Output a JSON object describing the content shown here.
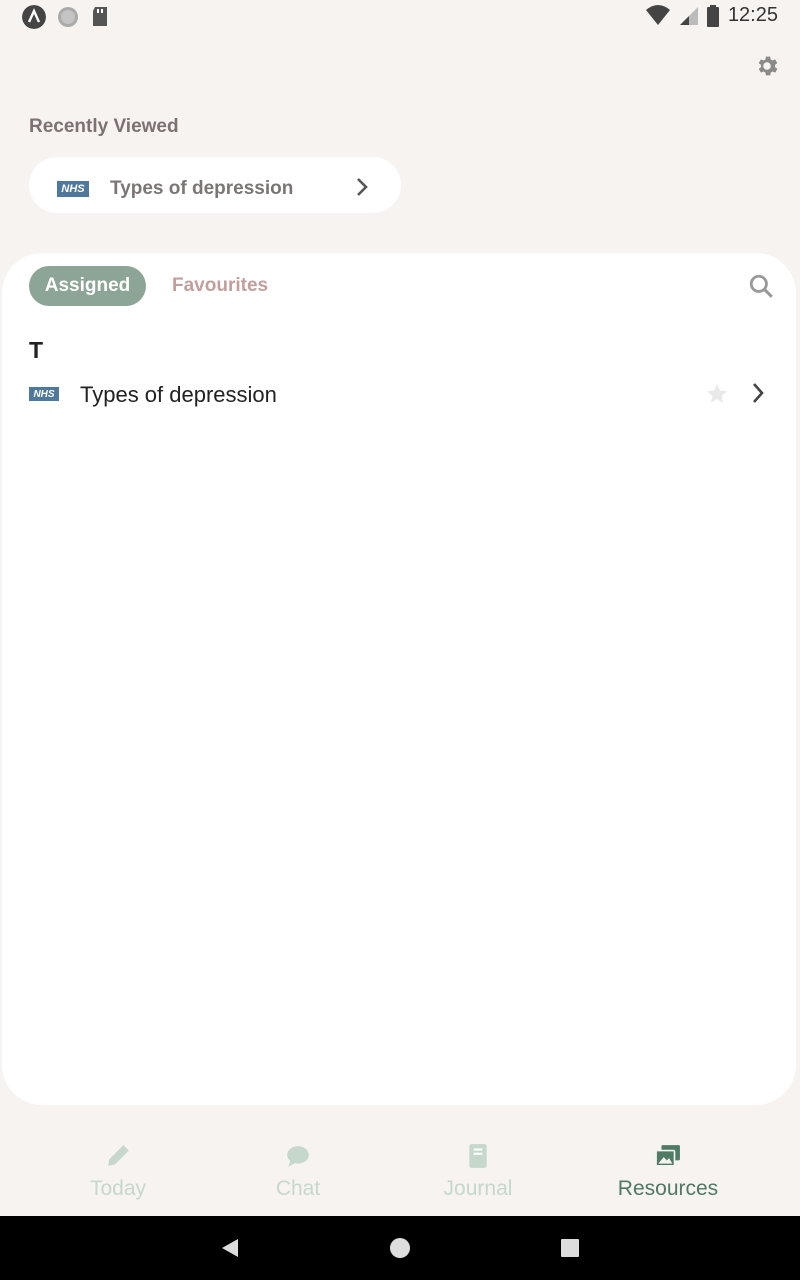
{
  "status_bar": {
    "time": "12:25"
  },
  "recently_viewed": {
    "title": "Recently Viewed",
    "item": {
      "badge": "NHS",
      "label": "Types of depression"
    }
  },
  "tabs": {
    "assigned": "Assigned",
    "favourites": "Favourites"
  },
  "section": {
    "letter": "T"
  },
  "resources": [
    {
      "badge": "NHS",
      "label": "Types of depression"
    }
  ],
  "nav": [
    {
      "label": "Today",
      "icon": "pencil-icon"
    },
    {
      "label": "Chat",
      "icon": "chat-bubble-icon"
    },
    {
      "label": "Journal",
      "icon": "book-icon"
    },
    {
      "label": "Resources",
      "icon": "images-icon"
    }
  ],
  "colors": {
    "accent": "#8da596",
    "nav_active": "#4f7a63",
    "nav_inactive": "#c6d8cc",
    "favourites_tab": "#c29e9c",
    "nhs_blue": "#4e789c"
  }
}
